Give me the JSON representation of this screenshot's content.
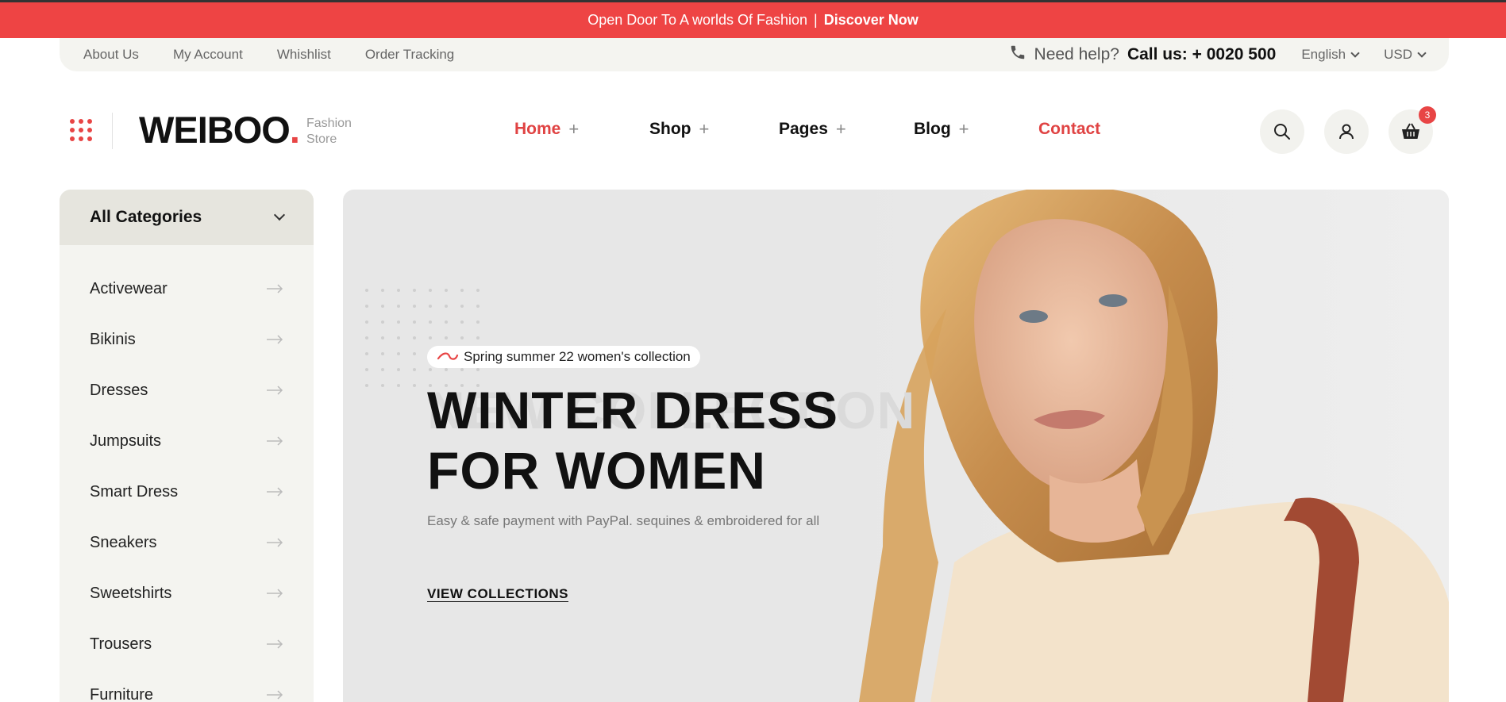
{
  "promo": {
    "text": "Open Door To A worlds Of Fashion",
    "separator": "|",
    "cta": "Discover Now"
  },
  "utility": {
    "links": [
      "About Us",
      "My Account",
      "Whishlist",
      "Order Tracking"
    ],
    "help_prefix": "Need help?",
    "help_call": "Call us: + 0020 500",
    "language": "English",
    "currency": "USD"
  },
  "header": {
    "logo": "WEIBOO",
    "logo_dot": ".",
    "tagline_1": "Fashion",
    "tagline_2": "Store",
    "nav": [
      {
        "label": "Home",
        "plus": "+"
      },
      {
        "label": "Shop",
        "plus": "+"
      },
      {
        "label": "Pages",
        "plus": "+"
      },
      {
        "label": "Blog",
        "plus": "+"
      },
      {
        "label": "Contact"
      }
    ],
    "cart_count": "3"
  },
  "sidebar": {
    "title": "All Categories",
    "items": [
      "Activewear",
      "Bikinis",
      "Dresses",
      "Jumpsuits",
      "Smart Dress",
      "Sneakers",
      "Sweetshirts",
      "Trousers",
      "Furniture"
    ]
  },
  "hero": {
    "pill": "Spring summer 22 women's collection",
    "ghost": "NEW COLLECTION",
    "title_line1": "WINTER DRESS",
    "title_line2": "FOR WOMEN",
    "subtitle": "Easy & safe payment with PayPal. sequines & embroidered for all",
    "cta": "VIEW COLLECTIONS"
  },
  "colors": {
    "accent": "#ee4444",
    "nav_active": "#e04343",
    "sidebar_bg": "#f4f4f0",
    "hero_bg": "#e7e7e7"
  }
}
